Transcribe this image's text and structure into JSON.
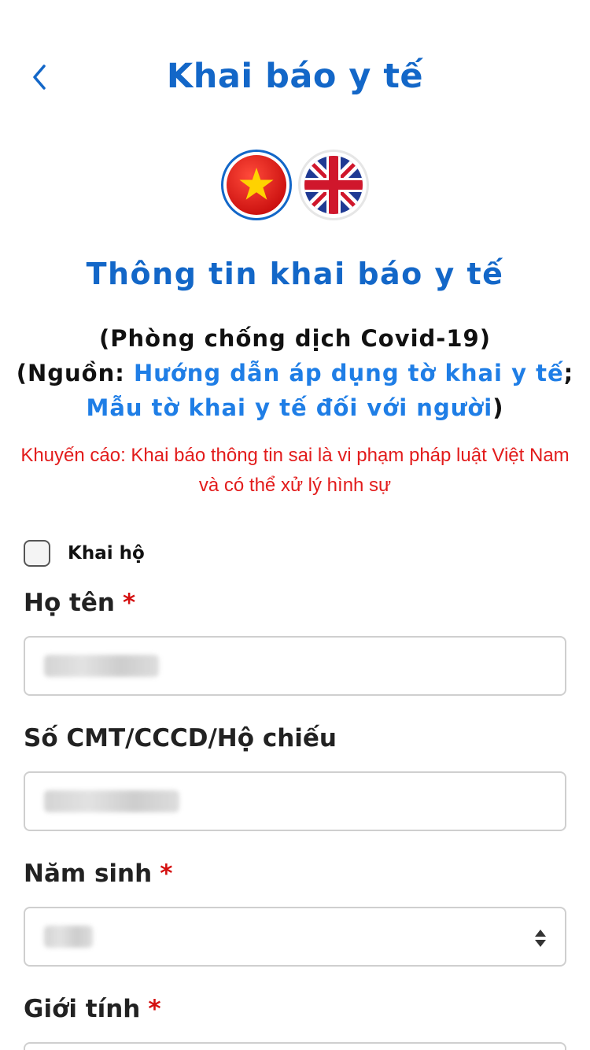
{
  "header": {
    "title": "Khai báo y tế"
  },
  "section": {
    "title": "Thông tin khai báo y tế"
  },
  "source": {
    "line1": "(Phòng chống dịch Covid-19)",
    "prefix": "(Nguồn: ",
    "link1": "Hướng dẫn áp dụng tờ khai y tế",
    "sep": ";",
    "link2": "Mẫu tờ khai y tế đối với người",
    "suffix": ")"
  },
  "warning": "Khuyến cáo: Khai báo thông tin sai là vi phạm pháp luật Việt Nam và có thể xử lý hình sự",
  "checkbox": {
    "label": "Khai hộ",
    "checked": false
  },
  "fields": {
    "name": {
      "label": "Họ tên",
      "required_mark": "*"
    },
    "id": {
      "label": "Số CMT/CCCD/Hộ chiếu"
    },
    "birth_year": {
      "label": "Năm sinh",
      "required_mark": "*"
    },
    "gender": {
      "label": "Giới tính",
      "required_mark": "*"
    }
  },
  "colors": {
    "accent": "#1367c8",
    "link": "#1f7ee6",
    "warning": "#e21b1b"
  },
  "icons": {
    "back": "chevron-left-icon",
    "select": "sort-arrows-icon"
  },
  "flags": [
    {
      "name": "vietnam-flag",
      "selected": true
    },
    {
      "name": "uk-flag",
      "selected": false
    }
  ]
}
